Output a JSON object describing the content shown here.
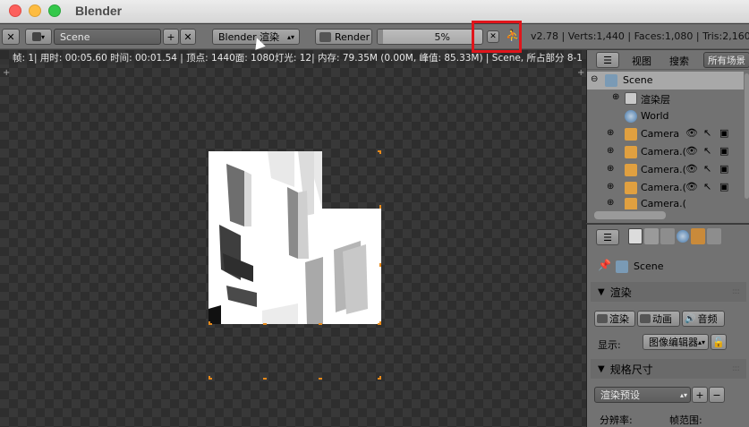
{
  "window": {
    "title": "Blender"
  },
  "header": {
    "scene_value": "Scene",
    "engine_label": "Blender 渲染",
    "render_label": "Render",
    "progress_text": "5%",
    "progress_fraction": 0.05,
    "stats_text": "v2.78 | Verts:1,440 | Faces:1,080 | Tris:2,160 |"
  },
  "editor": {
    "info_text": "帧: 1| 用时: 00:05.60 时间: 00:01.54 | 顶点: 1440面: 1080灯光: 12| 内存: 79.35M (0.00M, 峰值: 85.33M) | Scene, 所占部分 8-1"
  },
  "outliner": {
    "view_label": "视图",
    "search_label": "搜索",
    "scene_filter": "所有场景",
    "items": [
      {
        "label": "Scene",
        "icon": "scene-icon"
      },
      {
        "label": "渲染层",
        "icon": "render-layer-icon"
      },
      {
        "label": "World",
        "icon": "world-icon"
      },
      {
        "label": "Camera",
        "icon": "camera-icon"
      },
      {
        "label": "Camera.(",
        "icon": "camera-icon"
      },
      {
        "label": "Camera.(",
        "icon": "camera-icon"
      },
      {
        "label": "Camera.(",
        "icon": "camera-icon"
      },
      {
        "label": "Camera.(",
        "icon": "camera-icon"
      }
    ]
  },
  "properties": {
    "context_label": "Scene",
    "render_panel": "渲染",
    "render_btn": "渲染",
    "anim_btn": "动画",
    "audio_btn": "音频",
    "display_label": "显示:",
    "display_value": "图像编辑器",
    "dimensions_panel": "规格尺寸",
    "preset_value": "渲染预设",
    "resolution_label": "分辨率:",
    "frame_range_label": "帧范围:"
  },
  "colors": {
    "accent_orange": "#e88a1a",
    "highlight_red": "#e0151b",
    "selection": "#a8a8a8"
  }
}
